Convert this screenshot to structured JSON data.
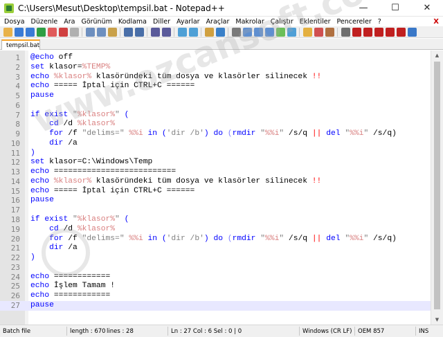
{
  "window": {
    "title": "C:\\Users\\Mesut\\Desktop\\tempsil.bat - Notepad++",
    "controls": {
      "minimize": "—",
      "maximize": "☐",
      "close": "✕"
    }
  },
  "menu": {
    "items": [
      "Dosya",
      "Düzenle",
      "Ara",
      "Görünüm",
      "Kodlama",
      "Diller",
      "Ayarlar",
      "Araçlar",
      "Makrolar",
      "Çalıştır",
      "Eklentiler",
      "Pencereler",
      "?"
    ],
    "close_glyph": "X"
  },
  "toolbar": {
    "colors": [
      "#e8b24a",
      "#3a7bd5",
      "#3a7bd5",
      "#2f9e44",
      "#e05b5b",
      "#d04040",
      "#b0b0b0",
      "#6d8fbf",
      "#6d8fbf",
      "#c9a14a",
      "#4a6fa8",
      "#4a6fa8",
      "#5a5a9a",
      "#5a5a9a",
      "#4fa0d6",
      "#4fa0d6",
      "#d0a040",
      "#3a80c8",
      "#7a7a7a",
      "#5f8fd0",
      "#5f8fd0",
      "#5f8fd0",
      "#6bbf59",
      "#4f9fd6",
      "#e4b040",
      "#d05050",
      "#b07040",
      "#6e6e6e",
      "#c02020",
      "#c02020",
      "#c02020",
      "#c02020",
      "#c02020",
      "#3a78c8"
    ]
  },
  "tabs": [
    {
      "label": "tempsil.bat"
    }
  ],
  "editor": {
    "current_line": 27,
    "lines": [
      {
        "n": "1"
      },
      {
        "n": "2"
      },
      {
        "n": "3"
      },
      {
        "n": "4"
      },
      {
        "n": "5"
      },
      {
        "n": "6"
      },
      {
        "n": "7"
      },
      {
        "n": "8"
      },
      {
        "n": "9"
      },
      {
        "n": "10"
      },
      {
        "n": "11"
      },
      {
        "n": "12"
      },
      {
        "n": "13"
      },
      {
        "n": "14"
      },
      {
        "n": "15"
      },
      {
        "n": "16"
      },
      {
        "n": "17"
      },
      {
        "n": "18"
      },
      {
        "n": "19"
      },
      {
        "n": "20"
      },
      {
        "n": "21"
      },
      {
        "n": "22"
      },
      {
        "n": "23"
      },
      {
        "n": "24"
      },
      {
        "n": "25"
      },
      {
        "n": "26"
      },
      {
        "n": "27"
      }
    ],
    "code": {
      "l1": [
        "@echo",
        " off"
      ],
      "l2": [
        "set",
        " klasor=",
        "%TEMP%"
      ],
      "l3": [
        "echo",
        " ",
        "%klasor%",
        " klasöründeki tüm dosya ve klasörler silinecek ",
        "!!",
        ""
      ],
      "l4": [
        "echo",
        " ===== İptal için CTRL+C ======"
      ],
      "l5": [
        "pause"
      ],
      "l7": [
        "if",
        " ",
        "exist",
        " ",
        "\"",
        "%klasor%",
        "\"",
        " ",
        "("
      ],
      "l8": [
        "    ",
        "cd",
        " /d ",
        "%klasor%"
      ],
      "l9": [
        "    ",
        "for",
        " /f ",
        "\"delims=\"",
        " ",
        "%%i",
        " ",
        "in",
        " (",
        "'dir /b'",
        ") ",
        "do",
        " (",
        "rmdir",
        " ",
        "\"",
        "%%i",
        "\"",
        " /s/q ",
        "||",
        " ",
        "del",
        " ",
        "\"",
        "%%i",
        "\"",
        " /s/q)"
      ],
      "l10": [
        "    ",
        "dir",
        " /a"
      ],
      "l11": [
        ")"
      ],
      "l12": [
        "set",
        " klasor=C:\\Windows\\Temp"
      ],
      "l13": [
        "echo",
        " =========================="
      ],
      "l14": [
        "echo",
        " ",
        "%klasor%",
        " klasöründeki tüm dosya ve klasörler silinecek ",
        "!!"
      ],
      "l15": [
        "echo",
        " ===== İptal için CTRL+C ======"
      ],
      "l16": [
        "pause"
      ],
      "l18": [
        "if",
        " ",
        "exist",
        " ",
        "\"",
        "%klasor%",
        "\"",
        " ",
        "("
      ],
      "l19": [
        "    ",
        "cd",
        " /d ",
        "%klasor%"
      ],
      "l20": [
        "    ",
        "for",
        " /f ",
        "\"delims=\"",
        " ",
        "%%i",
        " ",
        "in",
        " (",
        "'dir /b'",
        ") ",
        "do",
        " (",
        "rmdir",
        " ",
        "\"",
        "%%i",
        "\"",
        " /s/q ",
        "||",
        " ",
        "del",
        " ",
        "\"",
        "%%i",
        "\"",
        " /s/q)"
      ],
      "l21": [
        "    ",
        "dir",
        " /a"
      ],
      "l22": [
        ")"
      ],
      "l24": [
        "echo",
        " ============"
      ],
      "l25": [
        "echo",
        " İşlem Tamam !"
      ],
      "l26": [
        "echo",
        " ============"
      ],
      "l27": [
        "pause"
      ]
    }
  },
  "status": {
    "filetype": "Batch file",
    "length": "length : 670",
    "lines": "lines : 28",
    "position": "Ln : 27   Col : 6   Sel : 0 | 0",
    "eol": "Windows (CR LF)",
    "encoding": "OEM 857",
    "mode": "INS"
  },
  "watermark": "www.ozcansoft.com"
}
